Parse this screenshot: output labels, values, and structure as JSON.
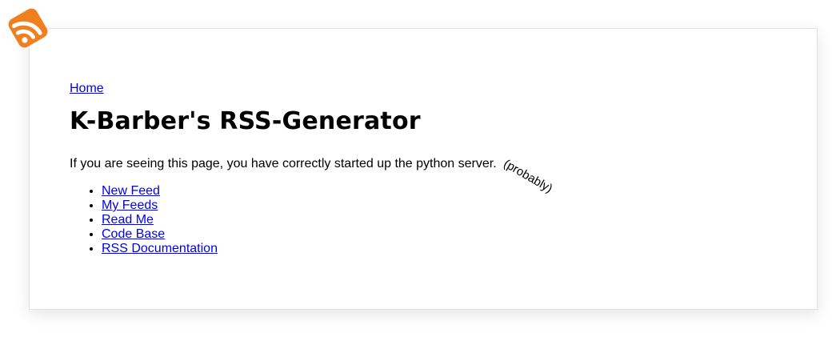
{
  "breadcrumb": {
    "home_label": "Home"
  },
  "page": {
    "title": "K-Barber's RSS-Generator",
    "intro": "If you are seeing this page, you have correctly started up the python server.",
    "aside": "(probably)"
  },
  "nav": {
    "items": [
      {
        "label": "New Feed"
      },
      {
        "label": "My Feeds"
      },
      {
        "label": "Read Me"
      },
      {
        "label": "Code Base"
      },
      {
        "label": "RSS Documentation"
      }
    ]
  },
  "colors": {
    "link": "#0000ee",
    "rss_orange": "#f0801e",
    "card_border": "#e2e2e2"
  },
  "icons": {
    "logo": "rss-icon"
  }
}
